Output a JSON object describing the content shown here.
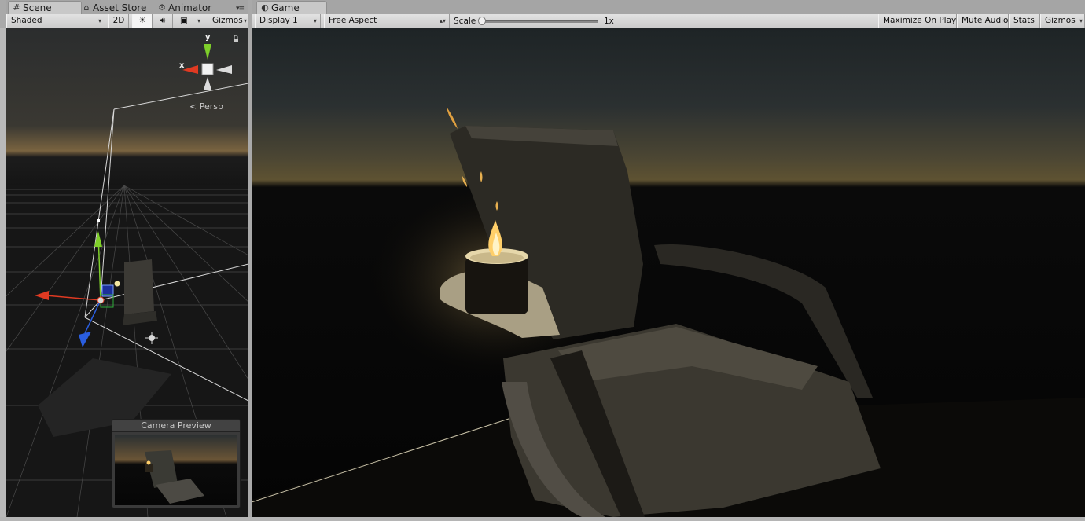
{
  "scene_panel": {
    "tabs": [
      {
        "label": "Scene",
        "icon": "grid-icon"
      },
      {
        "label": "Asset Store",
        "icon": "store-icon"
      },
      {
        "label": "Animator",
        "icon": "animator-icon"
      }
    ],
    "toolbar": {
      "shading_mode": "Shaded",
      "mode_2d": "2D",
      "gizmos": "Gizmos"
    },
    "orientation_gizmo": {
      "y_label": "y",
      "x_label": "x",
      "projection_label": "Persp"
    },
    "camera_preview_title": "Camera Preview"
  },
  "game_panel": {
    "tab": {
      "label": "Game",
      "icon": "game-controller-icon"
    },
    "toolbar": {
      "display": "Display 1",
      "aspect": "Free Aspect",
      "scale_label": "Scale",
      "scale_value": "1x",
      "scale_fraction": 0.0,
      "maximize_on_play": "Maximize On Play",
      "mute_audio": "Mute Audio",
      "stats": "Stats",
      "gizmos": "Gizmos"
    }
  },
  "colors": {
    "gizmo_x": "#e03a22",
    "gizmo_y": "#7fcf2a",
    "gizmo_z": "#2a5ee0",
    "flame": "#ffcf6a"
  }
}
